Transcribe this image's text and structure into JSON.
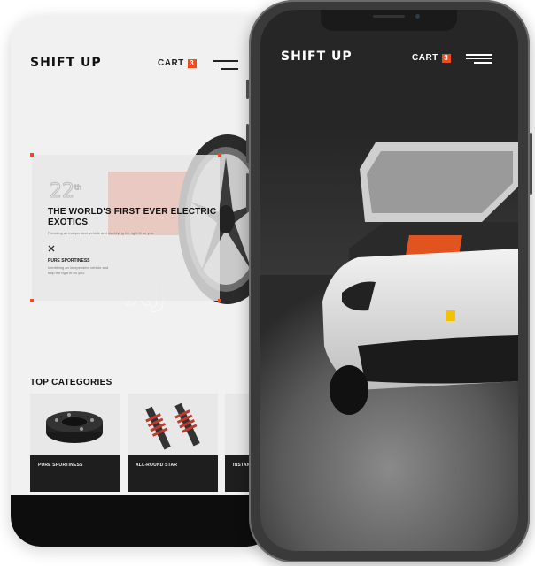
{
  "back_phone": {
    "header": {
      "logo": "SHIFT UP",
      "cart_label": "CART",
      "cart_count": "3"
    },
    "hero": {
      "number": "22",
      "number_sup": "th",
      "title": "THE WORLD'S FIRST EVER ELECTRIC EXOTICS",
      "text": "Providing an independent vehicle and identifying the right fit for you.",
      "feature_title": "PURE SPORTINESS",
      "feature_text": "Identifying an independent vehicle and help the right fit for you.",
      "watermark": "XJ"
    },
    "categories": {
      "title": "TOP CATEGORIES",
      "items": [
        {
          "label": "PURE SPORTINESS"
        },
        {
          "label": "ALL-ROUND STAR"
        },
        {
          "label": "INSTANT"
        }
      ]
    }
  },
  "front_phone": {
    "header": {
      "logo": "SHIFT UP",
      "cart_label": "CART",
      "cart_count": "3"
    }
  },
  "colors": {
    "accent": "#f04a1e",
    "dark": "#262626",
    "light": "#f1f1f1"
  }
}
